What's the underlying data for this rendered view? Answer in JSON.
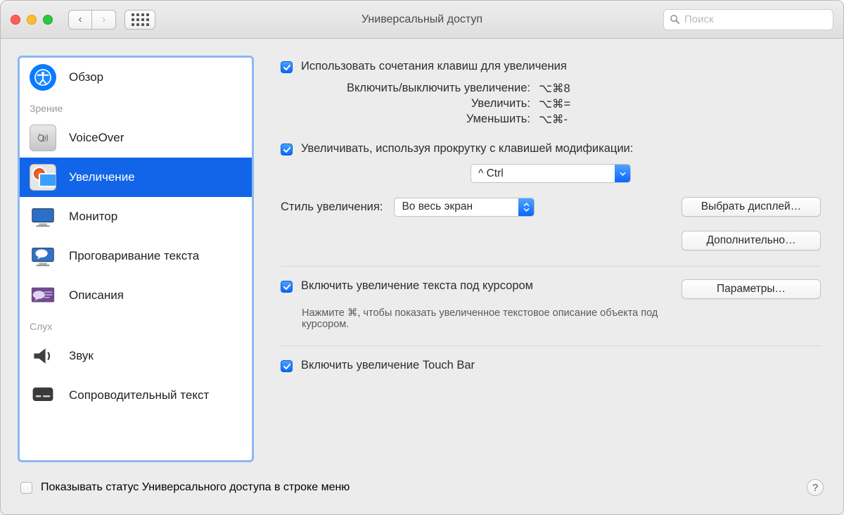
{
  "window": {
    "title": "Универсальный доступ"
  },
  "search": {
    "placeholder": "Поиск"
  },
  "sidebar": {
    "overview": "Обзор",
    "cat_vision": "Зрение",
    "voiceover": "VoiceOver",
    "zoom": "Увеличение",
    "display": "Монитор",
    "speech": "Проговаривание текста",
    "descriptions": "Описания",
    "cat_hearing": "Слух",
    "audio": "Звук",
    "captions": "Сопроводительный текст"
  },
  "main": {
    "use_shortcuts": "Использовать сочетания клавиш для увеличения",
    "shortcuts": {
      "toggle_label": "Включить/выключить увеличение:",
      "toggle_val": "⌥⌘8",
      "zoomin_label": "Увеличить:",
      "zoomin_val": "⌥⌘=",
      "zoomout_label": "Уменьшить:",
      "zoomout_val": "⌥⌘-"
    },
    "scroll_modifier": "Увеличивать, используя прокрутку с клавишей модификации:",
    "modifier_value": "^ Ctrl",
    "zoom_style_label": "Стиль увеличения:",
    "zoom_style_value": "Во весь экран",
    "choose_display": "Выбрать дисплей…",
    "advanced": "Дополнительно…",
    "hover_text": "Включить увеличение текста под курсором",
    "hover_hint": "Нажмите ⌘, чтобы показать увеличенное текстовое описание объекта под курсором.",
    "options": "Параметры…",
    "touchbar_zoom": "Включить увеличение Touch Bar"
  },
  "footer": {
    "show_status": "Показывать статус Универсального доступа в строке меню"
  }
}
